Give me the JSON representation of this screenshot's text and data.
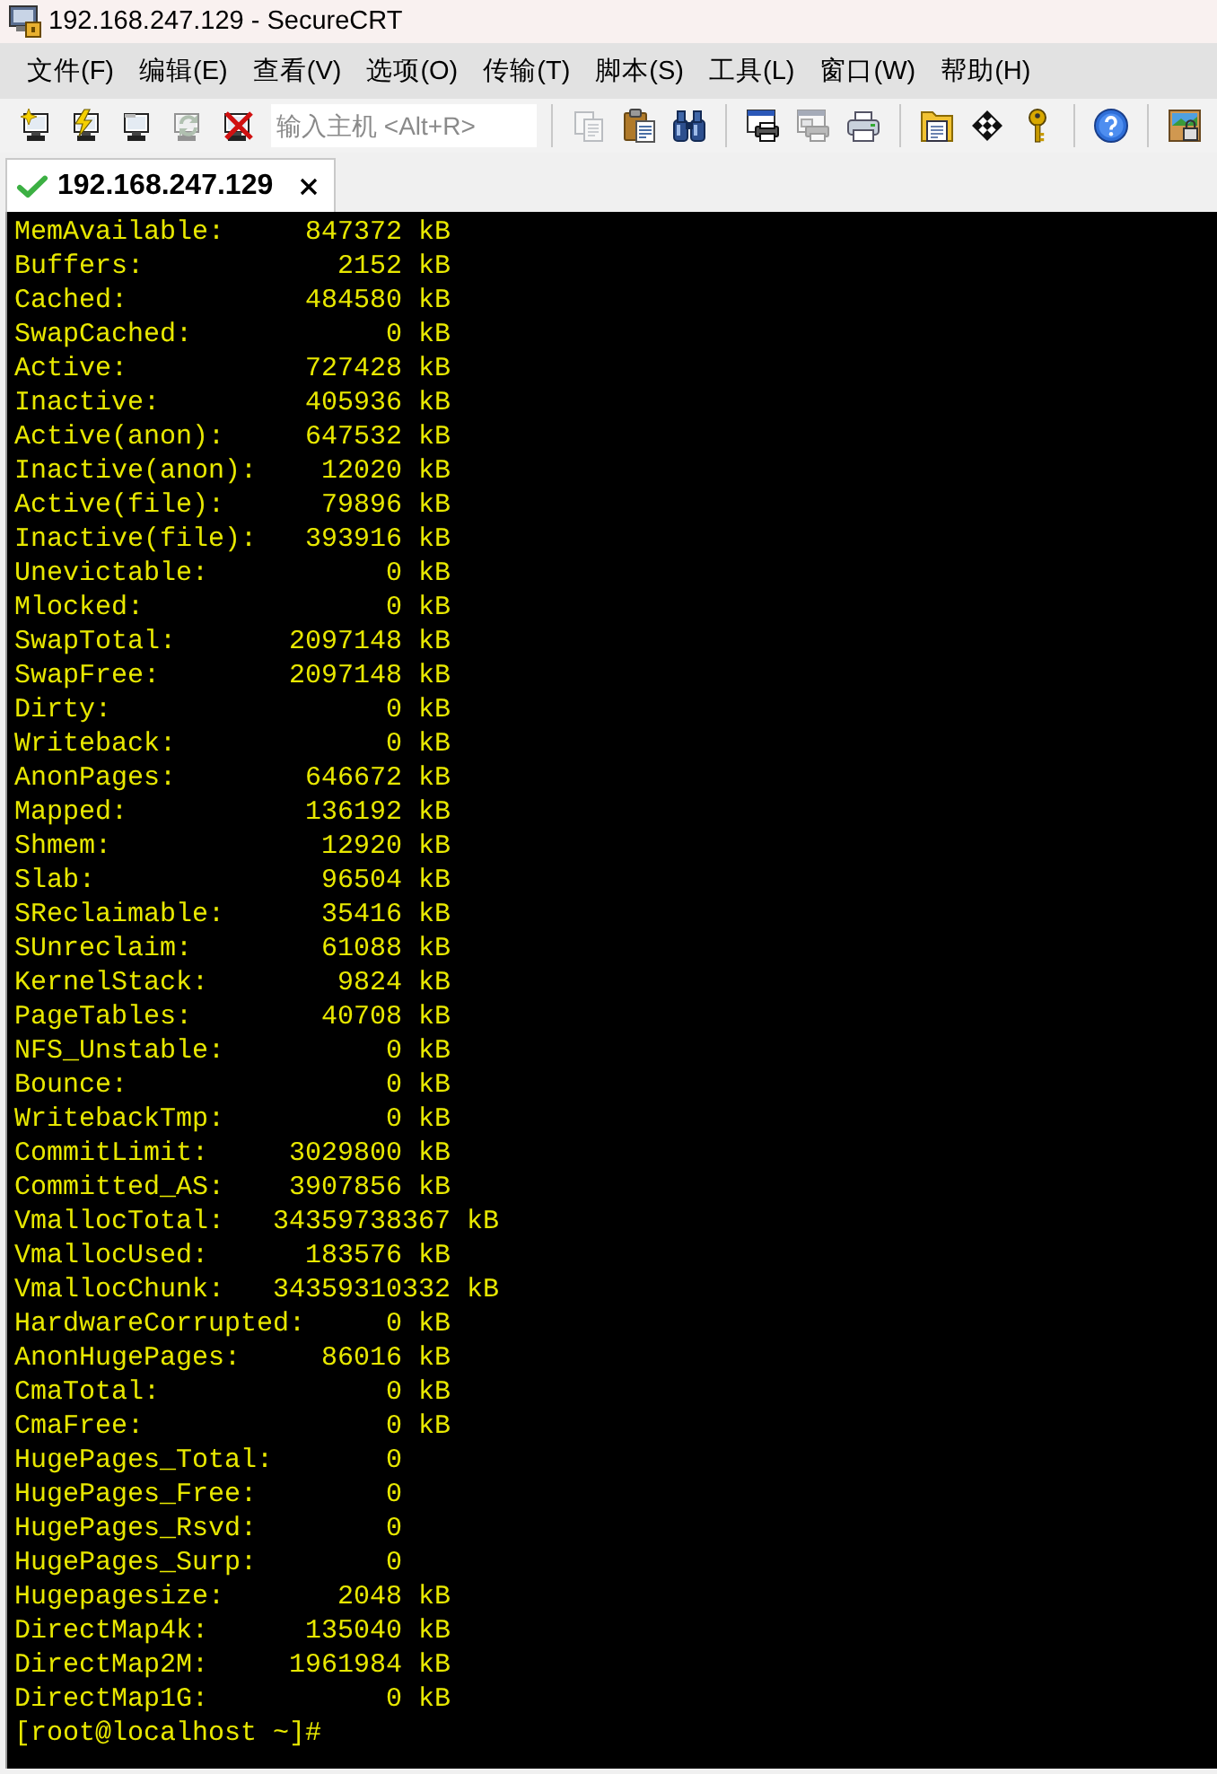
{
  "window": {
    "title": "192.168.247.129 - SecureCRT"
  },
  "menu": [
    {
      "label": "文件(F)"
    },
    {
      "label": "编辑(E)"
    },
    {
      "label": "查看(V)"
    },
    {
      "label": "选项(O)"
    },
    {
      "label": "传输(T)"
    },
    {
      "label": "脚本(S)"
    },
    {
      "label": "工具(L)"
    },
    {
      "label": "窗口(W)"
    },
    {
      "label": "帮助(H)"
    }
  ],
  "toolbar": {
    "groups": [
      {
        "items": [
          {
            "kind": "button",
            "disabled": false
          },
          {
            "kind": "button",
            "disabled": false
          },
          {
            "kind": "button",
            "disabled": false
          },
          {
            "kind": "button",
            "disabled": true
          },
          {
            "kind": "button",
            "disabled": false
          },
          {
            "kind": "field",
            "placeholder": "输入主机 <Alt+R>"
          }
        ]
      },
      {
        "items": [
          {
            "kind": "button",
            "disabled": true
          },
          {
            "kind": "button",
            "disabled": false
          },
          {
            "kind": "button",
            "disabled": false
          }
        ]
      },
      {
        "items": [
          {
            "kind": "button",
            "disabled": false
          },
          {
            "kind": "button",
            "disabled": true
          },
          {
            "kind": "button",
            "disabled": false
          }
        ]
      },
      {
        "items": [
          {
            "kind": "button",
            "disabled": false
          },
          {
            "kind": "button",
            "disabled": false
          },
          {
            "kind": "button",
            "disabled": false
          }
        ]
      },
      {
        "items": [
          {
            "kind": "button",
            "disabled": false
          }
        ]
      },
      {
        "items": [
          {
            "kind": "button",
            "disabled": false
          }
        ]
      }
    ]
  },
  "tabs": [
    {
      "label": "192.168.247.129",
      "selected": true,
      "connected": true
    }
  ],
  "terminal": {
    "lines": [
      {
        "key": "MemAvailable:",
        "value": "847372",
        "unit": "kB"
      },
      {
        "key": "Buffers:",
        "value": "2152",
        "unit": "kB"
      },
      {
        "key": "Cached:",
        "value": "484580",
        "unit": "kB"
      },
      {
        "key": "SwapCached:",
        "value": "0",
        "unit": "kB"
      },
      {
        "key": "Active:",
        "value": "727428",
        "unit": "kB"
      },
      {
        "key": "Inactive:",
        "value": "405936",
        "unit": "kB"
      },
      {
        "key": "Active(anon):",
        "value": "647532",
        "unit": "kB"
      },
      {
        "key": "Inactive(anon):",
        "value": "12020",
        "unit": "kB"
      },
      {
        "key": "Active(file):",
        "value": "79896",
        "unit": "kB"
      },
      {
        "key": "Inactive(file):",
        "value": "393916",
        "unit": "kB"
      },
      {
        "key": "Unevictable:",
        "value": "0",
        "unit": "kB"
      },
      {
        "key": "Mlocked:",
        "value": "0",
        "unit": "kB"
      },
      {
        "key": "SwapTotal:",
        "value": "2097148",
        "unit": "kB"
      },
      {
        "key": "SwapFree:",
        "value": "2097148",
        "unit": "kB"
      },
      {
        "key": "Dirty:",
        "value": "0",
        "unit": "kB"
      },
      {
        "key": "Writeback:",
        "value": "0",
        "unit": "kB"
      },
      {
        "key": "AnonPages:",
        "value": "646672",
        "unit": "kB"
      },
      {
        "key": "Mapped:",
        "value": "136192",
        "unit": "kB"
      },
      {
        "key": "Shmem:",
        "value": "12920",
        "unit": "kB"
      },
      {
        "key": "Slab:",
        "value": "96504",
        "unit": "kB"
      },
      {
        "key": "SReclaimable:",
        "value": "35416",
        "unit": "kB"
      },
      {
        "key": "SUnreclaim:",
        "value": "61088",
        "unit": "kB"
      },
      {
        "key": "KernelStack:",
        "value": "9824",
        "unit": "kB"
      },
      {
        "key": "PageTables:",
        "value": "40708",
        "unit": "kB"
      },
      {
        "key": "NFS_Unstable:",
        "value": "0",
        "unit": "kB"
      },
      {
        "key": "Bounce:",
        "value": "0",
        "unit": "kB"
      },
      {
        "key": "WritebackTmp:",
        "value": "0",
        "unit": "kB"
      },
      {
        "key": "CommitLimit:",
        "value": "3029800",
        "unit": "kB"
      },
      {
        "key": "Committed_AS:",
        "value": "3907856",
        "unit": "kB"
      },
      {
        "key": "VmallocTotal:",
        "value": "34359738367",
        "unit": "kB"
      },
      {
        "key": "VmallocUsed:",
        "value": "183576",
        "unit": "kB"
      },
      {
        "key": "VmallocChunk:",
        "value": "34359310332",
        "unit": "kB"
      },
      {
        "key": "HardwareCorrupted:",
        "value": "0",
        "unit": "kB"
      },
      {
        "key": "AnonHugePages:",
        "value": "86016",
        "unit": "kB"
      },
      {
        "key": "CmaTotal:",
        "value": "0",
        "unit": "kB"
      },
      {
        "key": "CmaFree:",
        "value": "0",
        "unit": "kB"
      },
      {
        "key": "HugePages_Total:",
        "value": "0"
      },
      {
        "key": "HugePages_Free:",
        "value": "0"
      },
      {
        "key": "HugePages_Rsvd:",
        "value": "0"
      },
      {
        "key": "HugePages_Surp:",
        "value": "0"
      },
      {
        "key": "Hugepagesize:",
        "value": "2048",
        "unit": "kB"
      },
      {
        "key": "DirectMap4k:",
        "value": "135040",
        "unit": "kB"
      },
      {
        "key": "DirectMap2M:",
        "value": "1961984",
        "unit": "kB"
      },
      {
        "key": "DirectMap1G:",
        "value": "0",
        "unit": "kB"
      }
    ],
    "prompt": "[root@localhost ~]#"
  }
}
